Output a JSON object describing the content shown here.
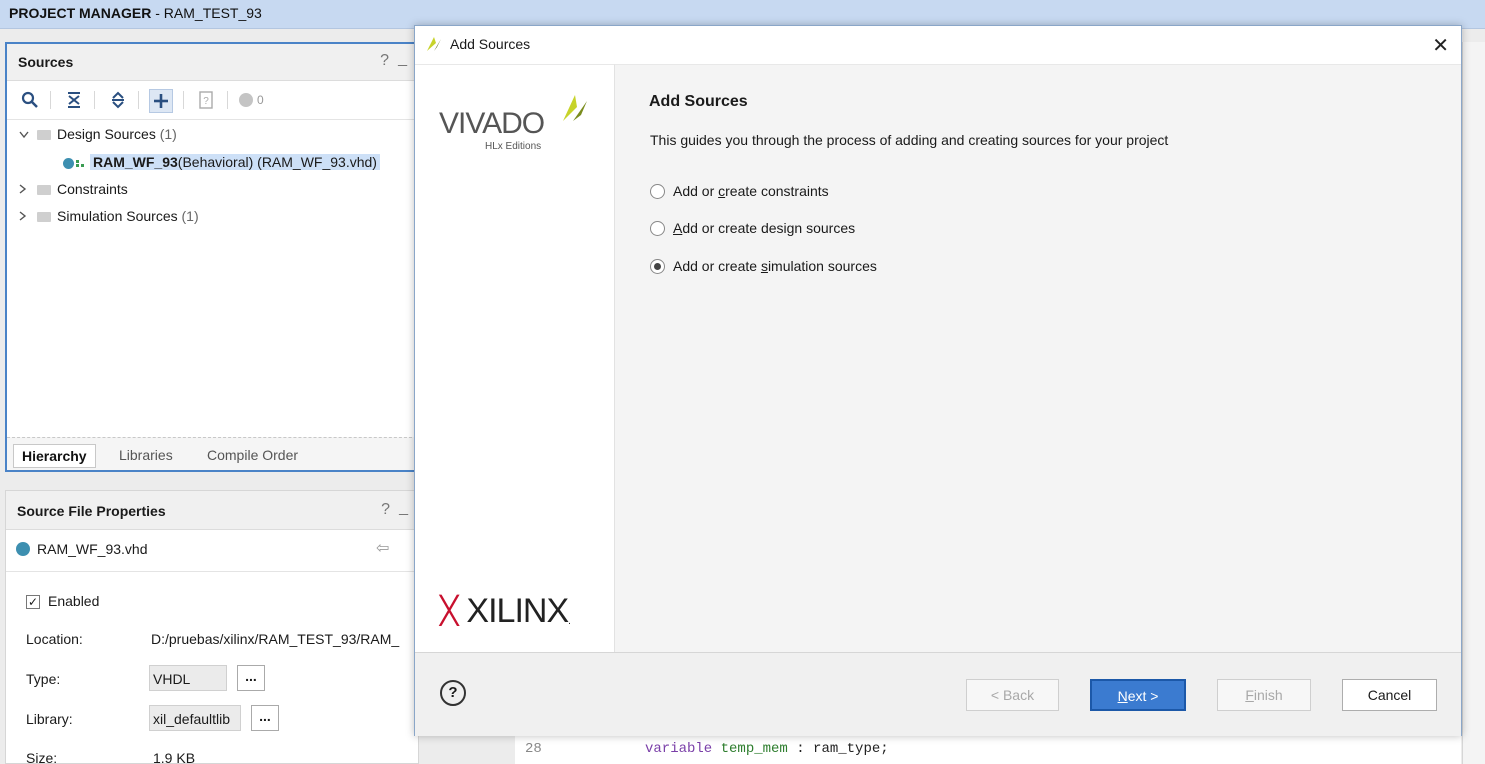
{
  "window": {
    "title_bold": "PROJECT MANAGER",
    "title_rest": " - RAM_TEST_93"
  },
  "sources_panel": {
    "title": "Sources",
    "help": "?",
    "minimize": "_",
    "toolbar_count": "0",
    "tree": [
      {
        "label": "Design Sources",
        "count": "(1)",
        "expanded": true
      },
      {
        "label_bold": "RAM_WF_93",
        "label_rest": "(Behavioral) (RAM_WF_93.vhd)"
      },
      {
        "label": "Constraints"
      },
      {
        "label": "Simulation Sources",
        "count": "(1)"
      }
    ],
    "tabs": [
      "Hierarchy",
      "Libraries",
      "Compile Order"
    ]
  },
  "properties_panel": {
    "title": "Source File Properties",
    "help": "?",
    "minimize": "_",
    "file": "RAM_WF_93.vhd",
    "enabled_label": "Enabled",
    "location_label": "Location:",
    "location_value": "D:/pruebas/xilinx/RAM_TEST_93/RAM_",
    "type_label": "Type:",
    "type_value": "VHDL",
    "library_label": "Library:",
    "library_value": "xil_defaultlib",
    "size_label": "Size:",
    "size_value": "1.9 KB",
    "dots": "..."
  },
  "background_code": {
    "line_number": "28",
    "keyword": "variable",
    "identifier": "temp_mem",
    "rest": " : ram_type;"
  },
  "dialog": {
    "title": "Add Sources",
    "close": "✕",
    "logo_vivado": "VIVADO",
    "logo_hlx": "HLx Editions",
    "logo_xilinx": "XILINX",
    "heading": "Add Sources",
    "description": "This guides you through the process of adding and creating sources for your project",
    "options": [
      {
        "pre": "Add or ",
        "u": "c",
        "post": "reate constraints",
        "selected": false
      },
      {
        "pre": "",
        "u": "A",
        "post": "dd or create design sources",
        "selected": false
      },
      {
        "pre": "Add or create ",
        "u": "s",
        "post": "imulation sources",
        "selected": true
      }
    ],
    "help": "?",
    "buttons": {
      "back": "< Back",
      "next_u": "N",
      "next_rest": "ext >",
      "finish_u": "F",
      "finish_rest": "inish",
      "cancel": "Cancel"
    }
  },
  "colors": {
    "accent": "#3b7bd0",
    "title_bar": "#c7d9f1",
    "xilinx_red": "#c8102e"
  }
}
